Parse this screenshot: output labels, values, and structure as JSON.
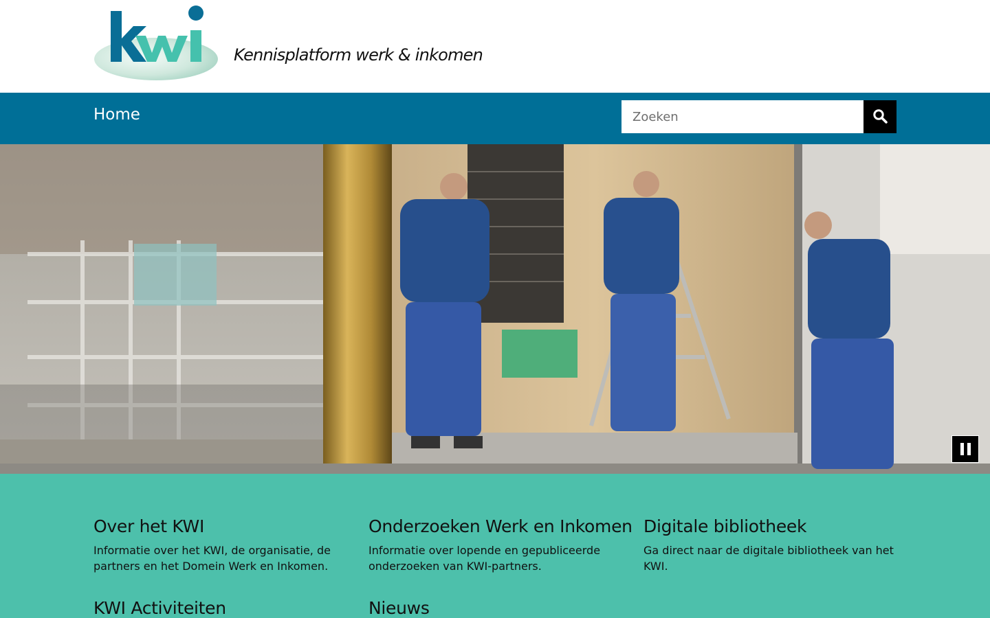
{
  "header": {
    "logo_text": "kwi",
    "tagline": "Kennisplatform werk & inkomen"
  },
  "nav": {
    "home_label": "Home",
    "search_placeholder": "Zoeken",
    "search_icon": "search-icon"
  },
  "hero": {
    "image_subject": "construction workers installing glass facade",
    "pause_icon": "pause-icon"
  },
  "cards": [
    {
      "title": "Over het KWI",
      "text": "Informatie over het KWI, de organisatie, de partners en het Domein Werk en Inkomen."
    },
    {
      "title": "Onderzoeken Werk en Inkomen",
      "text": "Informatie over lopende en gepubliceerde onderzoeken van KWI-partners."
    },
    {
      "title": "Digitale bibliotheek",
      "text": "Ga direct naar de digitale bibliotheek van het KWI."
    },
    {
      "title": "KWI Activiteiten",
      "text": ""
    },
    {
      "title": "Nieuws",
      "text": ""
    }
  ],
  "colors": {
    "nav_blue": "#006f97",
    "teal": "#4dc0ab",
    "logo_blue": "#0a6e96",
    "logo_green": "#45c1ad"
  }
}
